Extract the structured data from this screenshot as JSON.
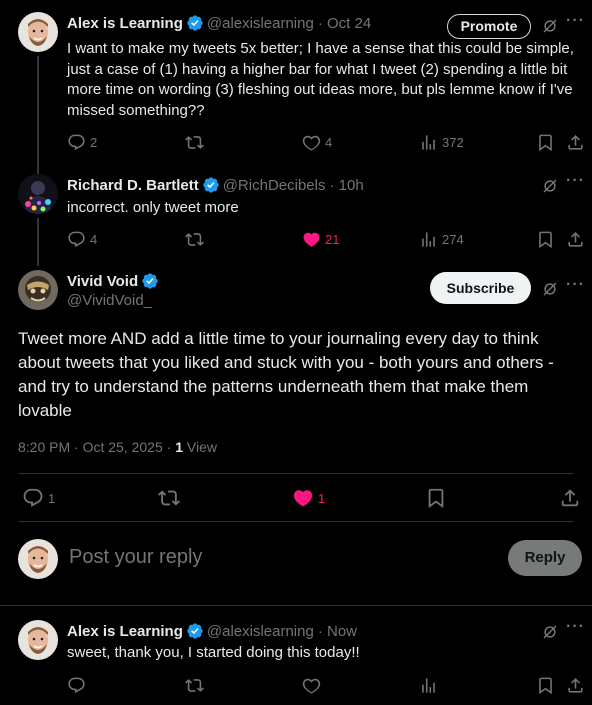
{
  "colors": {
    "verified": "#1d9bf0",
    "like_active": "#f91880",
    "muted": "#71767b"
  },
  "tweet1": {
    "name": "Alex is Learning",
    "handle": "@alexislearning",
    "time": "· Oct 24",
    "promote_label": "Promote",
    "text": "I want to make my tweets 5x better; I have a sense that this could be simple, just a case of (1) having a higher bar for what I tweet (2) spending a little bit more time on wording (3) fleshing out ideas more, but pls lemme know if I've missed something??",
    "replies": "2",
    "likes": "4",
    "views": "372"
  },
  "tweet2": {
    "name": "Richard D. Bartlett",
    "handle": "@RichDecibels",
    "time": "· 10h",
    "text": "incorrect. only tweet more",
    "replies": "4",
    "likes": "21",
    "views": "274"
  },
  "main_tweet": {
    "name": "Vivid Void",
    "handle": "@VividVoid_",
    "subscribe_label": "Subscribe",
    "text": "Tweet more AND add a little time to your journaling every day to think about tweets that you liked and stuck with you - both yours and others - and try to understand the patterns underneath them that make them lovable",
    "timestamp": "8:20 PM · Oct 25, 2025 · ",
    "view_count": "1",
    "view_label": "View",
    "replies": "1",
    "likes": "1"
  },
  "composer": {
    "placeholder": "Post your reply",
    "reply_label": "Reply"
  },
  "tweet4": {
    "name": "Alex is Learning",
    "handle": "@alexislearning",
    "time": "· Now",
    "text": "sweet, thank you, I started doing this today!!"
  }
}
